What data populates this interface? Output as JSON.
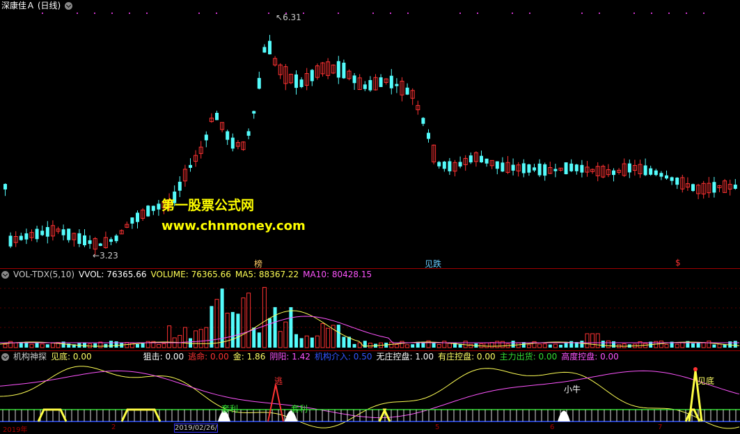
{
  "stock": {
    "title": "深康佳Ａ (日线)"
  },
  "price_panel": {
    "high_label": "6.31",
    "low_label": "3.23",
    "markers": [
      {
        "text": "榜",
        "color": "#ffcc66"
      },
      {
        "text": "见跌",
        "color": "#66ccff"
      },
      {
        "text": "$",
        "color": "#ff3333"
      }
    ],
    "watermark_line1": "第一股票公式网",
    "watermark_line2": "www.chnmoney.com"
  },
  "volume_panel": {
    "name": "VOL-TDX(5,10)",
    "vvol_label": "VVOL: 76365.66",
    "volume_label": "VOLUME: 76365.66",
    "ma5_label": "MA5: 88367.22",
    "ma10_label": "MA10: 80428.15"
  },
  "indicator_panel": {
    "name": "机构神探",
    "items": [
      {
        "label": "见底: 0.00",
        "color": "#ffff66"
      },
      {
        "label": "狙击: 0.00",
        "color": "#ffffff"
      },
      {
        "label": "逃命: 0.00",
        "color": "#ff3333"
      },
      {
        "label": "金: 1.86",
        "color": "#ffff66"
      },
      {
        "label": "阴阳: 1.42",
        "color": "#ff55ff"
      },
      {
        "label": "机构介入: 0.50",
        "color": "#3355ff"
      },
      {
        "label": "无庄控盘: 1.00",
        "color": "#ffffff"
      },
      {
        "label": "有庄控盘: 0.00",
        "color": "#ffff66"
      },
      {
        "label": "主力出货: 0.00",
        "color": "#33dd33"
      },
      {
        "label": "高度控盘: 0.00",
        "color": "#ff55ff"
      }
    ],
    "signal_labels": {
      "escape": "逃",
      "profit1": "套利",
      "profit2": "套利",
      "bull": "小牛",
      "bottom": "见底"
    }
  },
  "time_axis": {
    "labels": [
      "2019年",
      "2",
      "2019/02/26/",
      "5",
      "6",
      "7"
    ]
  },
  "colors": {
    "up": "#ff3232",
    "down": "#54fcfc",
    "background": "#000000",
    "separator": "#a00000"
  }
}
